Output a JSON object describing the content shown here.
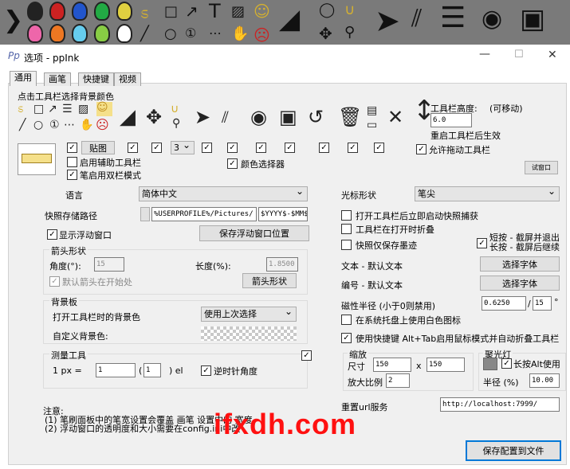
{
  "window": {
    "app_icon": "Pp",
    "title": "选项 - ppInk",
    "minimize": "—",
    "maximize": "☐",
    "close": "✕"
  },
  "tabs": [
    "通用",
    "画笔",
    "快捷键",
    "视频"
  ],
  "toolbar_section": {
    "title": "点击工具栏选择背景颜色"
  },
  "toolbar_height": {
    "label": "工具栏高度:",
    "movable": "(可移动)",
    "value": "6.0",
    "restart_note": "重启工具栏后生效"
  },
  "paste_button": "贴图",
  "aux_toolbar": "启用辅助工具栏",
  "pen_double": "笔启用双栏模式",
  "color_picker": "颜色选择器",
  "allow_drag_toolbar": "允许拖动工具栏",
  "test_window": "试窗口",
  "pages_select": "3",
  "language": {
    "label": "语言",
    "value": "简体中文"
  },
  "cursor_shape": {
    "label": "光标形状",
    "value": "笔尖"
  },
  "snapshot": {
    "label": "快照存储路径",
    "path": "%USERPROFILE%/Pictures/",
    "file": "$YYYY$-$MM$"
  },
  "float_window": {
    "show": "显示浮动窗口",
    "save_pos": "保存浮动窗口位置"
  },
  "arrow": {
    "group": "箭头形状",
    "angle_label": "角度(°):",
    "angle": "15",
    "length_label": "长度(%):",
    "length": "1.8500",
    "default_at_start": "默认箭头在开始处",
    "button": "箭头形状"
  },
  "background": {
    "group": "背景板",
    "open_label": "打开工具栏时的背景色",
    "open_value": "使用上次选择",
    "custom_label": "自定义背景色:"
  },
  "measure": {
    "group": "测量工具",
    "px_label": "1 px =",
    "value": "1",
    "paren_value": "1",
    "unit": ") el",
    "ccw": "逆时针角度"
  },
  "right_options": {
    "open_snapshot": "打开工具栏后立即启动快照捕获",
    "fold_on_open": "工具栏在打开时折叠",
    "snapshot_trace": "快照仅保存墨迹",
    "short_long": "短按 - 截屏并退出\n长按 - 截屏后继续"
  },
  "fonts": {
    "text_label": "文本  - 默认文本",
    "number_label": "编号  - 默认文本",
    "choose": "选择字体"
  },
  "magnet": {
    "label": "磁性半径 (小于0则禁用)",
    "value": "0.6250",
    "slash": "/",
    "value2": "15",
    "unit": "°"
  },
  "tray_white": "在系统托盘上使用白色图标",
  "alt_tab": "使用快捷键 Alt+Tab启用鼠标模式并自动折叠工具栏",
  "zoom": {
    "group": "缩放",
    "size_label": "尺寸",
    "w": "150",
    "x": "x",
    "h": "150",
    "scale_label": "放大比例",
    "scale": "2"
  },
  "spotlight": {
    "group": "聚光灯",
    "long_alt": "长按Alt使用",
    "radius_label": "半径 (%)",
    "radius": "10.00"
  },
  "url": {
    "label": "重置url服务",
    "value": "http://localhost:7999/"
  },
  "notes": {
    "title": "注意:",
    "line1": "(1) 笔刷面板中的笔宽设置会覆盖 画笔 设置中的 宽度",
    "line2": "(2) 浮动窗口的透明度和大小需要在config.ini中改"
  },
  "save_button": "保存配置到文件",
  "watermark": "ifxdh.com",
  "colors": {
    "accent": "#ff1010",
    "titlebar": "#ffffff",
    "client": "#f0f0f0",
    "highlight": "#f5e08a"
  }
}
